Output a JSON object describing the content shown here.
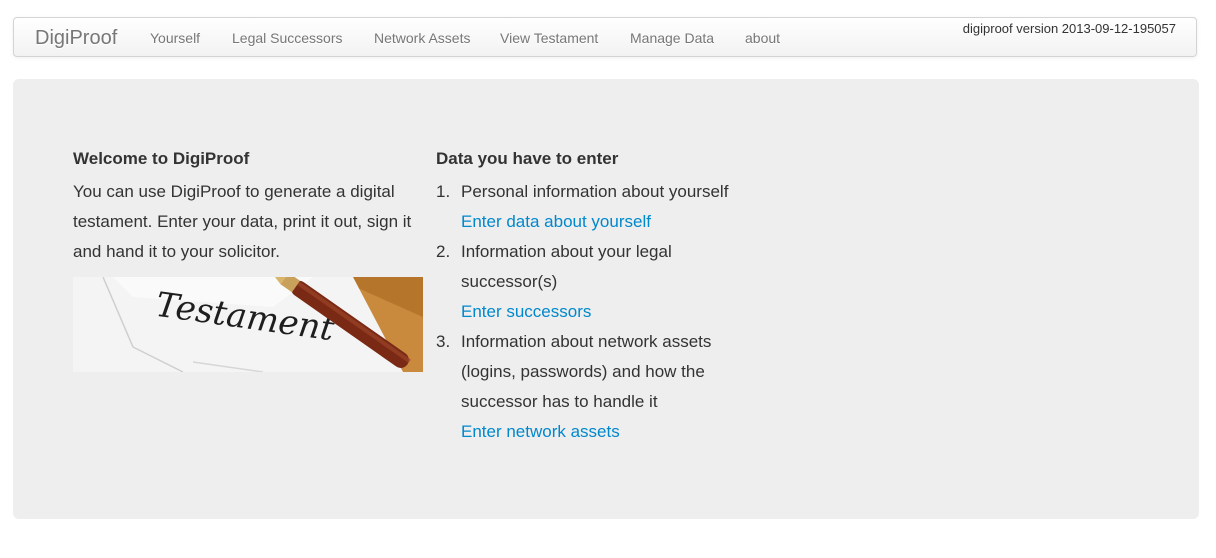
{
  "navbar": {
    "brand": "DigiProof",
    "items": [
      {
        "label": "Yourself"
      },
      {
        "label": "Legal Successors"
      },
      {
        "label": "Network Assets"
      },
      {
        "label": "View Testament"
      },
      {
        "label": "Manage Data"
      },
      {
        "label": "about"
      }
    ],
    "version": "digiproof version 2013-09-12-195057"
  },
  "welcome": {
    "title": "Welcome to DigiProof",
    "text": "You can use DigiProof to generate a digital testament. Enter your data, print it out, sign it and hand it to your solicitor.",
    "image_text": "Testament"
  },
  "data_section": {
    "title": "Data you have to enter",
    "steps": [
      {
        "num": "1.",
        "text": "Personal information about yourself",
        "link": "Enter data about yourself"
      },
      {
        "num": "2.",
        "text": "Information about your legal successor(s)",
        "link": "Enter successors"
      },
      {
        "num": "3.",
        "text": "Information about network assets (logins, passwords) and how the successor has to handle it",
        "link": "Enter network assets"
      }
    ]
  },
  "colors": {
    "link": "#0088cc",
    "hero_bg": "#eeeeee",
    "nav_text": "#777777"
  }
}
